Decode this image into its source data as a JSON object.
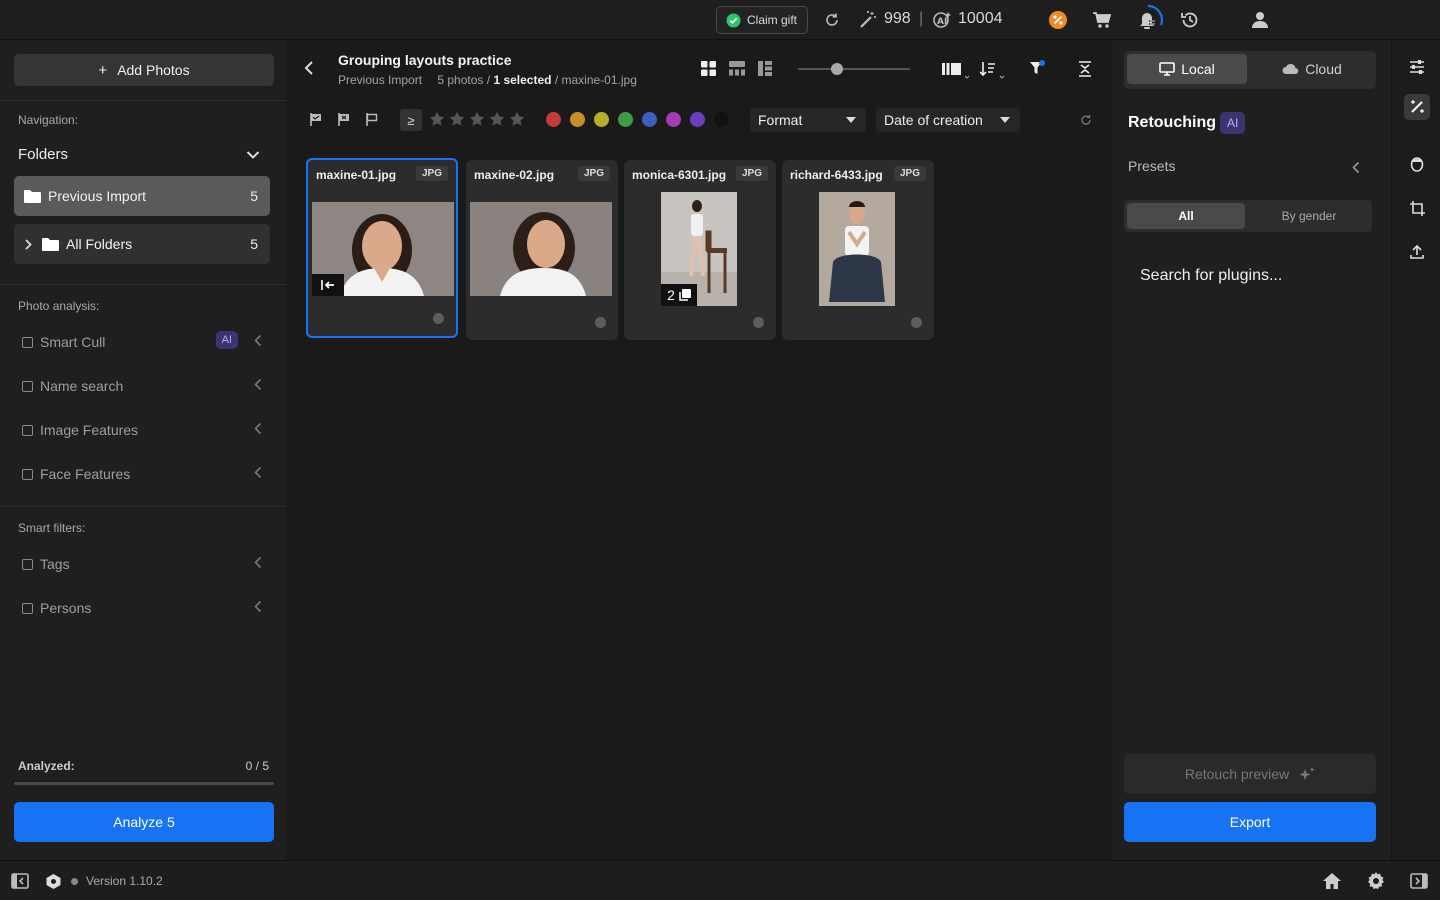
{
  "topbar": {
    "claim_label": "Claim gift",
    "credits_a": "998",
    "separator": "|",
    "credits_b": "10004",
    "icons": [
      "refresh-icon",
      "magic-wand-icon",
      "ai-credits-icon",
      "discount-icon",
      "cart-icon",
      "notification-icon",
      "history-icon",
      "user-icon"
    ]
  },
  "left": {
    "add_photos": "Add Photos",
    "navigation_label": "Navigation:",
    "folders_label": "Folders",
    "nav_items": [
      {
        "label": "Previous Import",
        "count": "5"
      },
      {
        "label": "All Folders",
        "count": "5"
      }
    ],
    "photo_analysis_label": "Photo analysis:",
    "analysis_filters": [
      {
        "label": "Smart Cull",
        "badge": "AI"
      },
      {
        "label": "Name search"
      },
      {
        "label": "Image Features"
      },
      {
        "label": "Face Features"
      }
    ],
    "smart_filters_label": "Smart filters:",
    "smart_filters": [
      {
        "label": "Tags"
      },
      {
        "label": "Persons"
      }
    ],
    "analyzed_label": "Analyzed:",
    "analyzed_value": "0 / 5",
    "analyzed_progress": 0,
    "analyze_button": "Analyze 5"
  },
  "center": {
    "title": "Grouping layouts practice",
    "sub_folder": "Previous Import",
    "sub_count": "5 photos /",
    "sub_selected": "1 selected",
    "sub_file": "/ maxine-01.jpg",
    "rating_operator": "≥",
    "color_labels": [
      "#c43b3b",
      "#c98f24",
      "#b3b02a",
      "#3e9c44",
      "#3c5fbf",
      "#a33bb3",
      "#6a3fbf",
      "#111111"
    ],
    "format_select": "Format",
    "sort_select": "Date of creation",
    "photos": [
      {
        "name": "maxine-01.jpg",
        "format": "JPG",
        "selected": true,
        "stack": ""
      },
      {
        "name": "maxine-02.jpg",
        "format": "JPG",
        "selected": false,
        "stack": ""
      },
      {
        "name": "monica-6301.jpg",
        "format": "JPG",
        "selected": false,
        "stack": "2"
      },
      {
        "name": "richard-6433.jpg",
        "format": "JPG",
        "selected": false,
        "stack": ""
      }
    ]
  },
  "right": {
    "local_label": "Local",
    "cloud_label": "Cloud",
    "retouching_label": "Retouching",
    "ai_badge": "AI",
    "presets_label": "Presets",
    "all_label": "All",
    "by_gender_label": "By gender",
    "search_plugins": "Search for plugins...",
    "retouch_preview": "Retouch preview",
    "export_label": "Export"
  },
  "footer": {
    "version": "Version 1.10.2"
  }
}
